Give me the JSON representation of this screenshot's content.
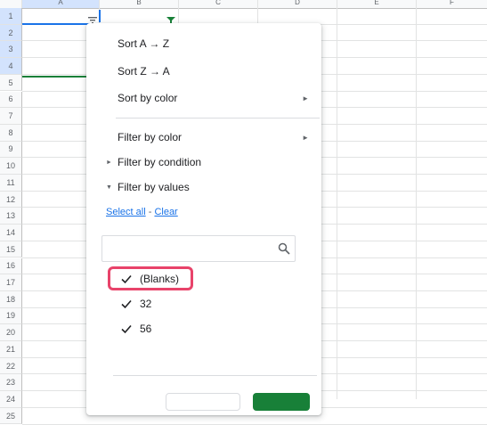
{
  "sheet": {
    "columns": [
      "A",
      "B",
      "C",
      "D",
      "E",
      "F"
    ],
    "rows": [
      "1",
      "2",
      "3",
      "4",
      "5",
      "6",
      "7",
      "8",
      "9",
      "10",
      "11",
      "12",
      "13",
      "14",
      "15",
      "16",
      "17",
      "18",
      "19",
      "20",
      "21",
      "22",
      "23",
      "24",
      "25"
    ]
  },
  "menu": {
    "sort_az": "Sort A → Z",
    "sort_za": "Sort Z → A",
    "sort_by_color": "Sort by color",
    "filter_by_color": "Filter by color",
    "filter_by_condition": "Filter by condition",
    "filter_by_values": "Filter by values",
    "select_all": "Select all",
    "separator": "-",
    "clear": "Clear",
    "search_placeholder": "",
    "values": [
      {
        "label": "(Blanks)",
        "checked": true
      },
      {
        "label": "32",
        "checked": true
      },
      {
        "label": "56",
        "checked": true
      }
    ]
  },
  "colors": {
    "accent_green": "#188038",
    "link_blue": "#1a73e8",
    "highlight": "#e8436a"
  }
}
